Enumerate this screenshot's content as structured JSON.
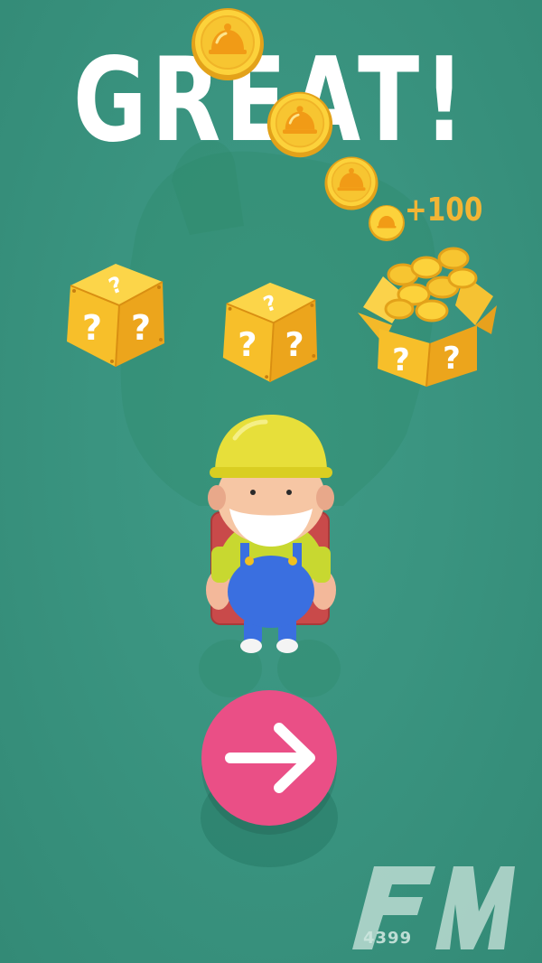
{
  "title": "GREAT!",
  "reward": {
    "label": "+100"
  },
  "coins": {
    "count": 4,
    "icon": "cloche-coin-icon"
  },
  "mystery_boxes": [
    {
      "name": "box-1",
      "state": "closed",
      "marks": [
        "?",
        "?",
        "?"
      ]
    },
    {
      "name": "box-2",
      "state": "closed",
      "marks": [
        "?",
        "?",
        "?"
      ]
    },
    {
      "name": "box-3",
      "state": "opened-with-coins",
      "marks": [
        "?",
        "?"
      ]
    }
  ],
  "character": {
    "name": "miner-character"
  },
  "next_button": {
    "icon": "arrow-right-icon",
    "color": "#ea4f86"
  },
  "watermark": {
    "letters": "FM",
    "number": "4399"
  },
  "colors": {
    "background": "#3a9480",
    "gold": "#f7c531",
    "gold_dark": "#e3a21a",
    "button": "#ea4f86",
    "reward_text": "#f2b535"
  }
}
